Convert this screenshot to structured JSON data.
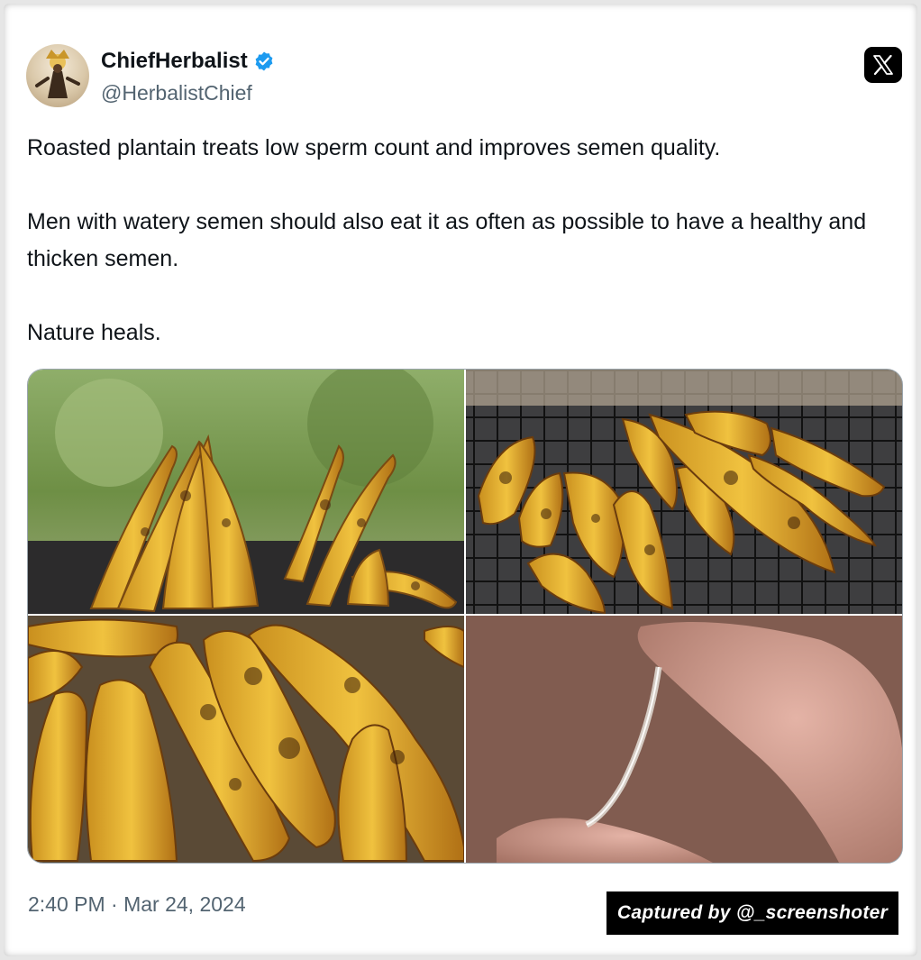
{
  "author": {
    "display_name": "ChiefHerbalist",
    "handle": "@HerbalistChief",
    "verified": true,
    "avatar_icon": "herbalist-avatar"
  },
  "platform_icon": "x-logo-icon",
  "tweet": {
    "paragraphs": [
      "Roasted plantain treats low sperm count and improves semen quality.",
      "Men with watery semen should also eat it as often as possible to have a healthy and thicken semen.",
      "Nature heals."
    ]
  },
  "media": {
    "images": [
      {
        "subject": "roasted plantains stacked on grill, green background"
      },
      {
        "subject": "plantains roasting on charcoal grill grate"
      },
      {
        "subject": "close-up of charred roasted plantains"
      },
      {
        "subject": "close-up of fingers"
      }
    ]
  },
  "timestamp": "2:40 PM · Mar 24, 2024",
  "watermark": "Captured by @_screenshoter",
  "colors": {
    "verified_blue": "#1d9bf0",
    "text_primary": "#0f1419",
    "text_secondary": "#536471",
    "plantain_yellow": "#e8b630"
  }
}
